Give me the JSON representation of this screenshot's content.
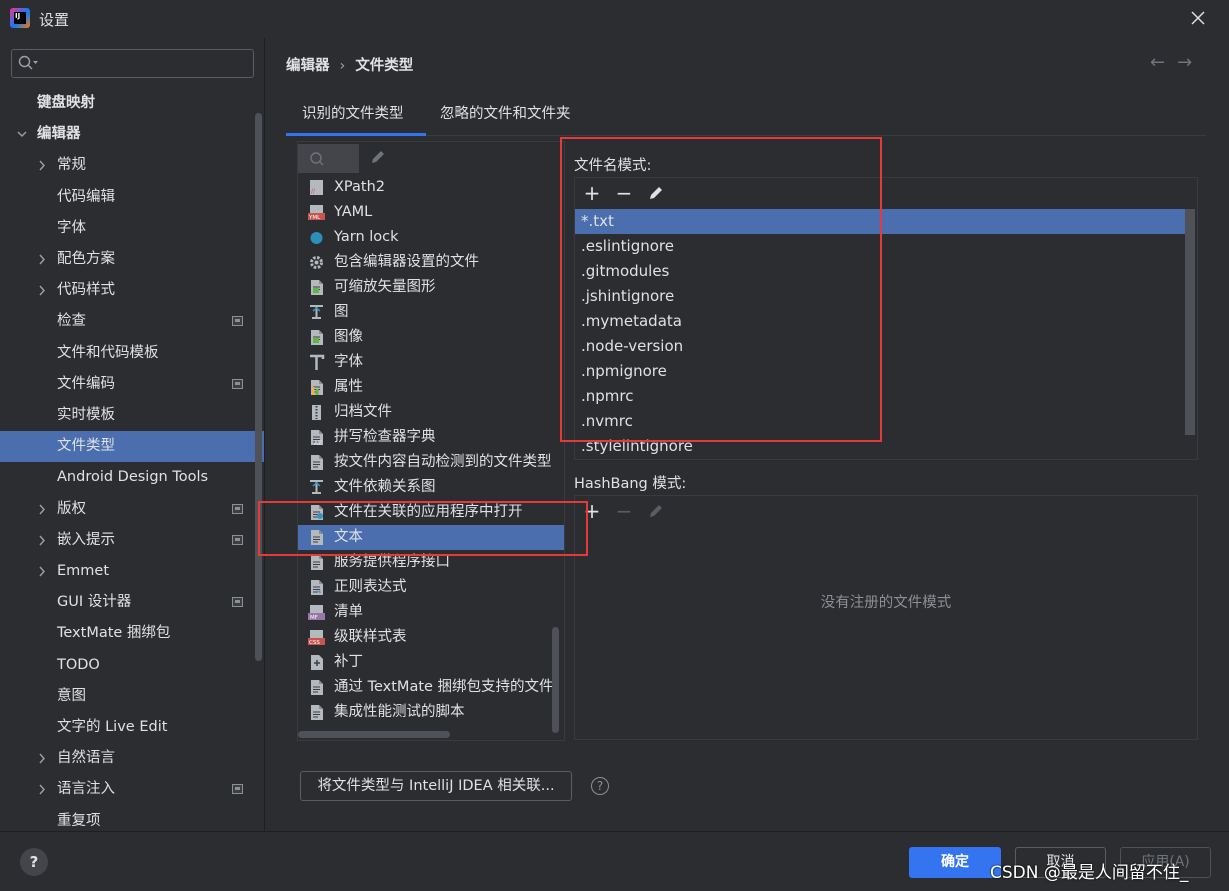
{
  "window": {
    "title": "设置",
    "logo_text": "IJ"
  },
  "search": {
    "placeholder": ""
  },
  "sidebar": {
    "items": [
      {
        "label": "键盘映射",
        "bold": true
      },
      {
        "label": "编辑器",
        "bold": true,
        "expanded": true
      },
      {
        "label": "常规",
        "collapsible": true
      },
      {
        "label": "代码编辑"
      },
      {
        "label": "字体"
      },
      {
        "label": "配色方案",
        "collapsible": true
      },
      {
        "label": "代码样式",
        "collapsible": true
      },
      {
        "label": "检查",
        "project_icon": true
      },
      {
        "label": "文件和代码模板"
      },
      {
        "label": "文件编码",
        "project_icon": true
      },
      {
        "label": "实时模板"
      },
      {
        "label": "文件类型",
        "selected": true
      },
      {
        "label": "Android Design Tools"
      },
      {
        "label": "版权",
        "collapsible": true,
        "project_icon": true
      },
      {
        "label": "嵌入提示",
        "collapsible": true,
        "project_icon": true
      },
      {
        "label": "Emmet",
        "collapsible": true
      },
      {
        "label": "GUI 设计器",
        "project_icon": true
      },
      {
        "label": "TextMate 捆绑包"
      },
      {
        "label": "TODO"
      },
      {
        "label": "意图"
      },
      {
        "label": "文字的 Live Edit"
      },
      {
        "label": "自然语言",
        "collapsible": true
      },
      {
        "label": "语言注入",
        "collapsible": true,
        "project_icon": true
      },
      {
        "label": "重复项"
      }
    ]
  },
  "breadcrumb": {
    "parent": "编辑器",
    "separator": "›",
    "current": "文件类型"
  },
  "nav": {
    "back": "←",
    "forward": "→"
  },
  "tabs": [
    {
      "label": "识别的文件类型",
      "active": true
    },
    {
      "label": "忽略的文件和文件夹"
    }
  ],
  "file_types": [
    {
      "label": "XPath2",
      "icon": "xpath-icon"
    },
    {
      "label": "YAML",
      "icon": "yaml-icon"
    },
    {
      "label": "Yarn lock",
      "icon": "yarn-icon"
    },
    {
      "label": "包含编辑器设置的文件",
      "icon": "gear-icon"
    },
    {
      "label": "可缩放矢量图形",
      "icon": "svg-file-icon"
    },
    {
      "label": "图",
      "icon": "diagram-icon"
    },
    {
      "label": "图像",
      "icon": "image-file-icon"
    },
    {
      "label": "字体",
      "icon": "font-icon"
    },
    {
      "label": "属性",
      "icon": "properties-icon"
    },
    {
      "label": "归档文件",
      "icon": "archive-icon"
    },
    {
      "label": "拼写检查器字典",
      "icon": "dictionary-icon"
    },
    {
      "label": "按文件内容自动检测到的文件类型",
      "icon": "text-file-icon"
    },
    {
      "label": "文件依赖关系图",
      "icon": "diagram-icon"
    },
    {
      "label": "文件在关联的应用程序中打开",
      "icon": "external-app-icon"
    },
    {
      "label": "文本",
      "icon": "text-file-icon",
      "selected": true
    },
    {
      "label": "服务提供程序接口",
      "icon": "text-file-icon"
    },
    {
      "label": "正则表达式",
      "icon": "regex-file-icon"
    },
    {
      "label": "清单",
      "icon": "manifest-icon"
    },
    {
      "label": "级联样式表",
      "icon": "css-icon"
    },
    {
      "label": "补丁",
      "icon": "patch-icon"
    },
    {
      "label": "通过 TextMate 捆绑包支持的文件",
      "icon": "text-file-icon"
    },
    {
      "label": "集成性能测试的脚本",
      "icon": "text-file-icon"
    }
  ],
  "filename_patterns": {
    "label": "文件名模式:",
    "add": "+",
    "remove": "−",
    "items": [
      "*.txt",
      ".eslintignore",
      ".gitmodules",
      ".jshintignore",
      ".mymetadata",
      ".node-version",
      ".npmignore",
      ".npmrc",
      ".nvmrc",
      ".stylelintignore"
    ],
    "selected_index": 0
  },
  "hashbang_patterns": {
    "label": "HashBang 模式:",
    "add": "+",
    "remove": "−",
    "empty_text": "没有注册的文件模式"
  },
  "associate_button": "将文件类型与 IntelliJ IDEA 相关联...",
  "help_small": "?",
  "footer": {
    "help": "?",
    "ok": "确定",
    "cancel": "取消",
    "apply": "应用(A)",
    "watermark": "CSDN @最是人间留不住_"
  },
  "colors": {
    "background": "#2b2d30",
    "selection": "#4b6eaf",
    "accent": "#3574f0",
    "highlight_box": "#e63a3a"
  }
}
